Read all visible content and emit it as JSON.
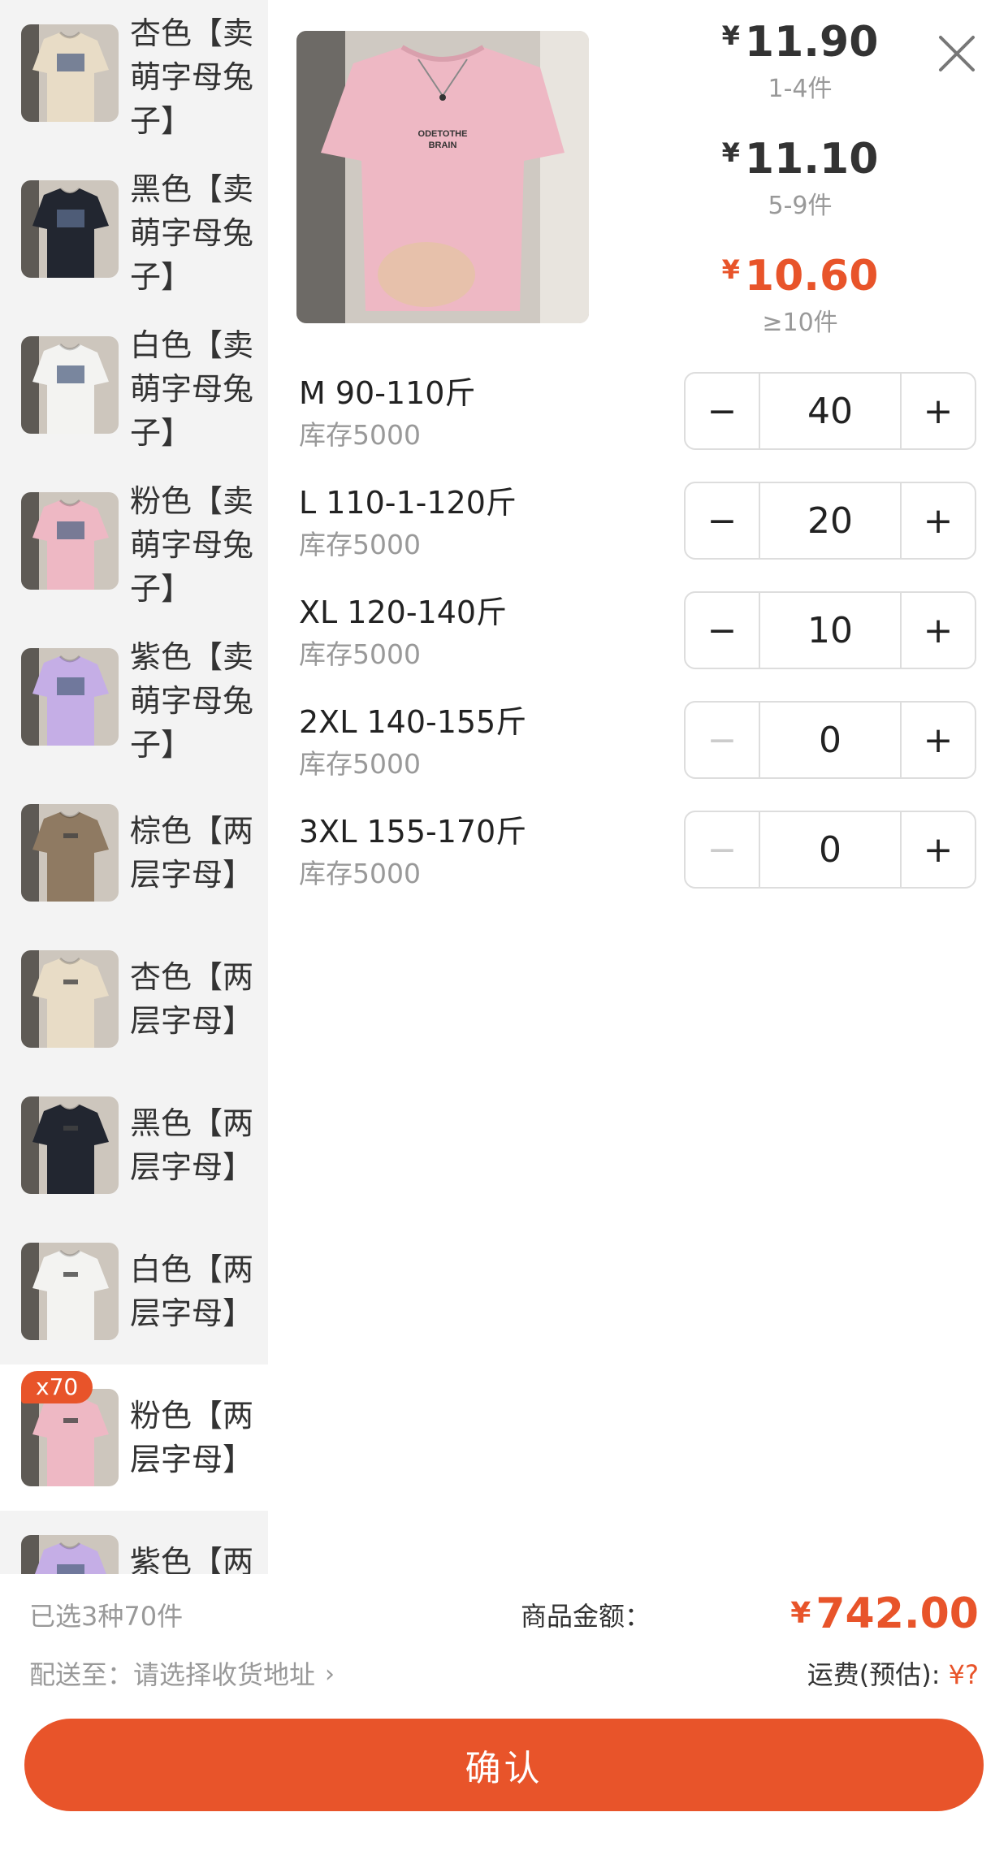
{
  "variants": [
    {
      "label": "杏色【卖萌字母兔子】",
      "color": "#e8dcc6"
    },
    {
      "label": "黑色【卖萌字母兔子】",
      "color": "#222630"
    },
    {
      "label": "白色【卖萌字母兔子】",
      "color": "#f3f3f1"
    },
    {
      "label": "粉色【卖萌字母兔子】",
      "color": "#eeb8c4"
    },
    {
      "label": "紫色【卖萌字母兔子】",
      "color": "#c5aee6"
    },
    {
      "label": "棕色【两层字母】",
      "color": "#8f7a62"
    },
    {
      "label": "杏色【两层字母】",
      "color": "#e8dcc6"
    },
    {
      "label": "黑色【两层字母】",
      "color": "#222630"
    },
    {
      "label": "白色【两层字母】",
      "color": "#f3f3f1"
    },
    {
      "label": "粉色【两层字母】",
      "color": "#eeb8c4",
      "badge": "x70"
    },
    {
      "label": "紫色【两",
      "color": "#c5aee6"
    }
  ],
  "preview": {
    "shirt_text_1": "ODETOTHE",
    "shirt_text_2": "BRAIN",
    "color": "#eeb8c4"
  },
  "tiers": [
    {
      "currency": "¥",
      "price": "11.90",
      "range": "1-4件"
    },
    {
      "currency": "¥",
      "price": "11.10",
      "range": "5-9件"
    },
    {
      "currency": "¥",
      "price": "10.60",
      "range": "≥10件"
    }
  ],
  "sizes": [
    {
      "name": "M 90-110斤",
      "stock": "库存5000",
      "qty": "40",
      "minus": "−",
      "plus": "+"
    },
    {
      "name": "L 110-1-120斤",
      "stock": "库存5000",
      "qty": "20",
      "minus": "−",
      "plus": "+"
    },
    {
      "name": "XL 120-140斤",
      "stock": "库存5000",
      "qty": "10",
      "minus": "−",
      "plus": "+"
    },
    {
      "name": "2XL 140-155斤",
      "stock": "库存5000",
      "qty": "0",
      "minus": "−",
      "plus": "+"
    },
    {
      "name": "3XL 155-170斤",
      "stock": "库存5000",
      "qty": "0",
      "minus": "−",
      "plus": "+"
    }
  ],
  "footer": {
    "selected_summary": "已选3种70件",
    "ship_to_label": "配送至：",
    "ship_to_value": "请选择收货地址",
    "chevron": "›",
    "total_label": "商品金额：",
    "total_currency": "¥",
    "total_amount": "742.00",
    "freight_label": "运费(预估):",
    "freight_value": "¥?",
    "confirm_label": "确认"
  },
  "colors": {
    "accent": "#e8542a",
    "sidebar_bg": "#f3f3f3"
  }
}
